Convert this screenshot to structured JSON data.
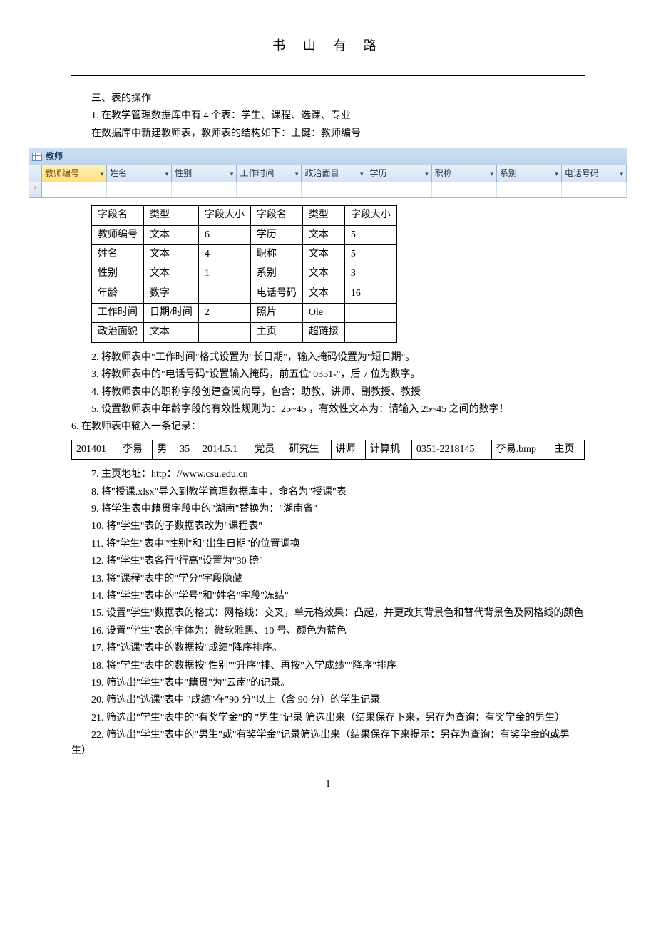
{
  "running_title": "书 山 有  路",
  "section_title": "三、表的操作",
  "intro_lines": [
    "1.  在教学管理数据库中有 4 个表：学生、课程、选课、专业",
    "在数据库中新建教师表，教师表的结构如下：主键：教师编号"
  ],
  "datasheet": {
    "title": "教师",
    "newrow_marker": "*",
    "columns": [
      "教师编号",
      "姓名",
      "性别",
      "工作时间",
      "政治面目",
      "学历",
      "职称",
      "系别",
      "电话号码"
    ]
  },
  "schema": {
    "headers": [
      "字段名",
      "类型",
      "字段大小",
      "字段名",
      "类型",
      "字段大小"
    ],
    "rows": [
      [
        "教师编号",
        "文本",
        "6",
        "学历",
        "文本",
        "5"
      ],
      [
        "姓名",
        "文本",
        "4",
        "职称",
        "文本",
        "5"
      ],
      [
        "性别",
        "文本",
        "1",
        "系别",
        "文本",
        "3"
      ],
      [
        "年龄",
        "数字",
        "",
        "电话号码",
        "文本",
        "16"
      ],
      [
        "工作时间",
        "日期/时间",
        "2",
        "照片",
        "Ole",
        ""
      ],
      [
        "政治面貌",
        "文本",
        "",
        "主页",
        "超链接",
        ""
      ]
    ]
  },
  "mid_items": [
    "2.  将教师表中\"工作时间\"格式设置为\"长日期\"，输入掩码设置为\"短日期\"。",
    "3.  将教师表中的\"电话号码\"设置输入掩码，前五位\"0351-\"，后 7 位为数字。",
    "4.  将教师表中的职称字段创建查阅向导，包含：助教、讲师、副教授、教授",
    "5. 设置教师表中年龄字段的有效性规则为：25~45      ，有效性文本为：请输入 25~45 之间的数字！",
    "6.   在教师表中输入一条记录："
  ],
  "record_row": [
    "201401",
    "李易",
    "男",
    "35",
    "2014.5.1",
    "党员",
    "研究生",
    "讲师",
    "计算机",
    "0351-2218145",
    "李易.bmp",
    "主页"
  ],
  "item7_prefix": "7. 主页地址：http：",
  "item7_link": "//www.csu.edu.cn",
  "tail_items": [
    "8.  将\"授课.xlsx\"导入到教学管理数据库中，命名为\"授课\"表",
    "9. 将学生表中籍贯字段中的\"湖南\"替换为：\"湖南省\"",
    "10. 将\"学生\"表的子数据表改为\"课程表\"",
    "11. 将\"学生\"表中\"性别\"和\"出生日期\"的位置调换",
    "12. 将\"学生\"表各行\"行高\"设置为\"30 磅\"",
    "13. 将\"课程\"表中的\"学分\"字段隐藏",
    "14. 将\"学生\"表中的\"学号\"和\"姓名\"字段\"冻结\"",
    "15. 设置\"学生\"数据表的格式：网格线：交叉，单元格效果：凸起，并更改其背景色和替代背景色及网格线的颜色",
    "16. 设置\"学生\"表的字体为：微软雅黑、10 号、颜色为蓝色",
    "17.  将\"选课\"表中的数据按\"成绩\"降序排序。",
    "18.  将\"学生\"表中的数据按\"性别\"\"升序\"排、再按\"入学成绩\"\"降序\"排序",
    "19. 筛选出\"学生\"表中\"籍贯\"为\"云南\"的记录。",
    "20. 筛选出\"选课\"表中  \"成绩\"在\"90 分\"以上（含 90 分）的学生记录",
    "21. 筛选出\"学生\"表中的\"有奖学金\"的 \"男生\"记录 筛选出来（结果保存下来，另存为查询：有奖学金的男生）",
    "22. 筛选出\"学生\"表中的\"男生\"或\"有奖学金\"记录筛选出来（结果保存下来提示：另存为查询：有奖学金的或男生）"
  ],
  "page_number": "1"
}
